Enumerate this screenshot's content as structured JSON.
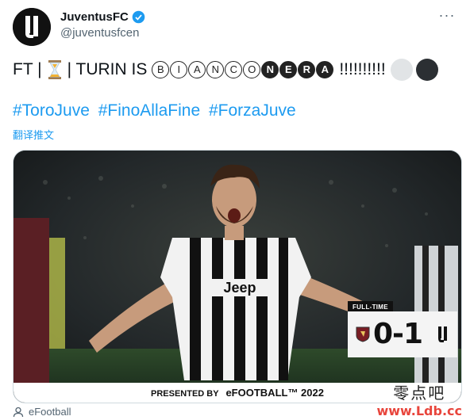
{
  "account": {
    "display_name": "JuventusFC",
    "handle": "@juventusfcen",
    "avatar_icon": "juventus-logo-icon",
    "verified_icon": "verified-badge-icon"
  },
  "tweet": {
    "prefix": "FT |",
    "mid": "| TURIN IS",
    "letters_open": [
      "B",
      "I",
      "A",
      "N",
      "C",
      "O"
    ],
    "letters_filled": [
      "N",
      "E",
      "R",
      "A"
    ],
    "exclaims": "!!!!!!!!!!",
    "hashtags": [
      "#ToroJuve",
      "#FinoAllaFine",
      "#ForzaJuve"
    ],
    "translate": "翻译推文"
  },
  "media": {
    "full_time_label": "FULL-TIME",
    "score": "0-1",
    "sponsor_prefix": "PRESENTED BY",
    "sponsor_name": "eFOOTBALL™ 2022",
    "shirt_text": "Jeep"
  },
  "footer": {
    "source": "eFootball"
  },
  "watermark": {
    "cn": "零点吧",
    "url": "www.Ldb.cc"
  },
  "colors": {
    "link": "#1d9bf0",
    "text": "#0f1419",
    "muted": "#536471",
    "watermark_red": "#e8453c"
  }
}
